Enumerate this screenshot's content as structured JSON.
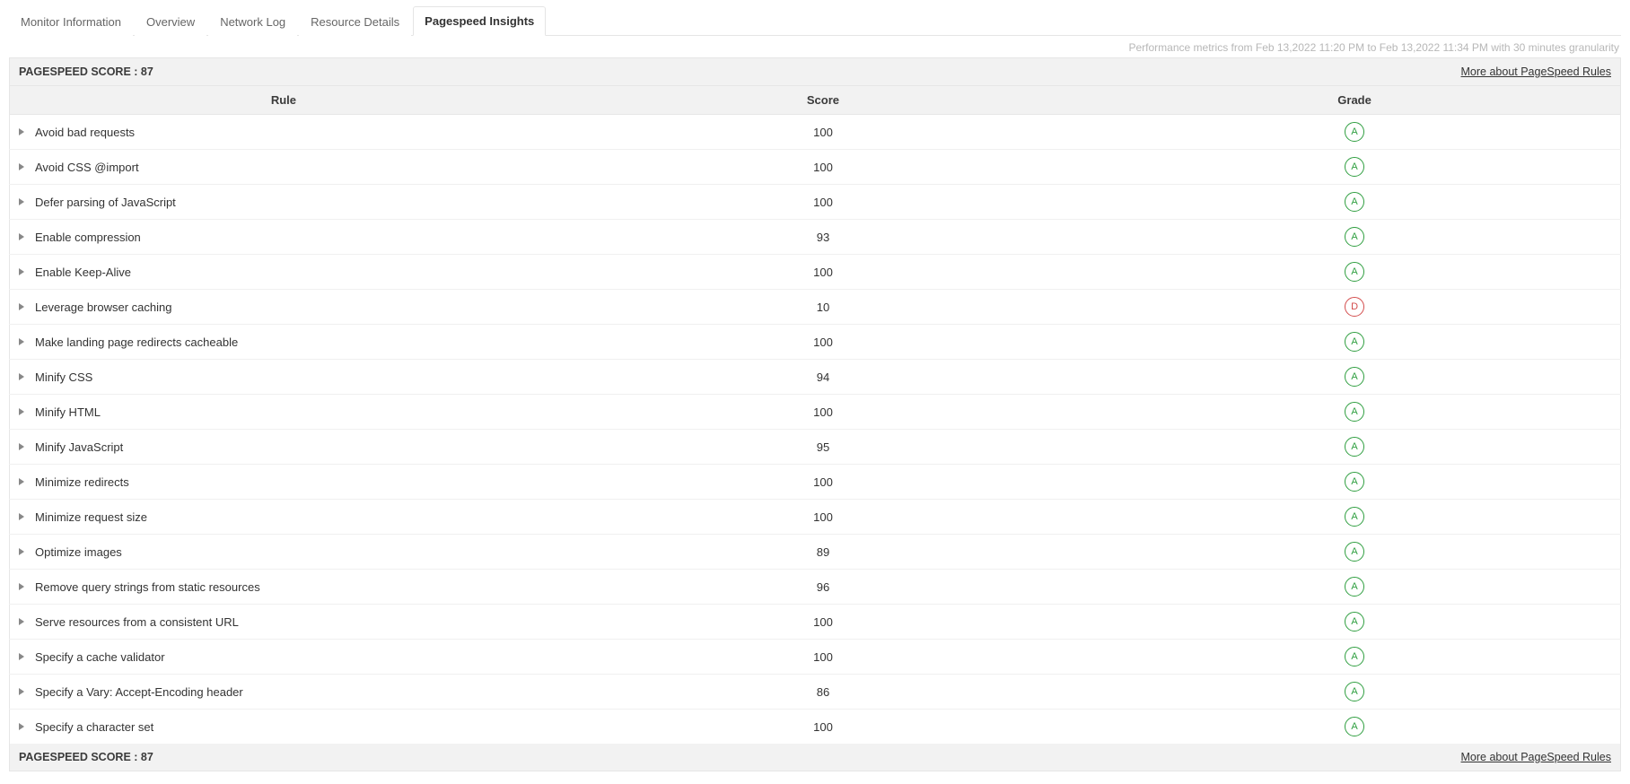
{
  "tabs": [
    {
      "label": "Monitor Information",
      "active": false
    },
    {
      "label": "Overview",
      "active": false
    },
    {
      "label": "Network Log",
      "active": false
    },
    {
      "label": "Resource Details",
      "active": false
    },
    {
      "label": "Pagespeed Insights",
      "active": true
    }
  ],
  "metrics_text": "Performance metrics from Feb 13,2022 11:20 PM to Feb 13,2022 11:34 PM with 30 minutes granularity",
  "score_header": {
    "label": "PAGESPEED SCORE : 87",
    "more_link": "More about PageSpeed Rules"
  },
  "columns": {
    "rule": "Rule",
    "score": "Score",
    "grade": "Grade"
  },
  "rows": [
    {
      "rule": "Avoid bad requests",
      "score": "100",
      "grade": "A"
    },
    {
      "rule": "Avoid CSS @import",
      "score": "100",
      "grade": "A"
    },
    {
      "rule": "Defer parsing of JavaScript",
      "score": "100",
      "grade": "A"
    },
    {
      "rule": "Enable compression",
      "score": "93",
      "grade": "A"
    },
    {
      "rule": "Enable Keep-Alive",
      "score": "100",
      "grade": "A"
    },
    {
      "rule": "Leverage browser caching",
      "score": "10",
      "grade": "D"
    },
    {
      "rule": "Make landing page redirects cacheable",
      "score": "100",
      "grade": "A"
    },
    {
      "rule": "Minify CSS",
      "score": "94",
      "grade": "A"
    },
    {
      "rule": "Minify HTML",
      "score": "100",
      "grade": "A"
    },
    {
      "rule": "Minify JavaScript",
      "score": "95",
      "grade": "A"
    },
    {
      "rule": "Minimize redirects",
      "score": "100",
      "grade": "A"
    },
    {
      "rule": "Minimize request size",
      "score": "100",
      "grade": "A"
    },
    {
      "rule": "Optimize images",
      "score": "89",
      "grade": "A"
    },
    {
      "rule": "Remove query strings from static resources",
      "score": "96",
      "grade": "A"
    },
    {
      "rule": "Serve resources from a consistent URL",
      "score": "100",
      "grade": "A"
    },
    {
      "rule": "Specify a cache validator",
      "score": "100",
      "grade": "A"
    },
    {
      "rule": "Specify a Vary: Accept-Encoding header",
      "score": "86",
      "grade": "A"
    },
    {
      "rule": "Specify a character set",
      "score": "100",
      "grade": "A"
    }
  ],
  "score_footer": {
    "label": "PAGESPEED SCORE : 87",
    "more_link": "More about PageSpeed Rules"
  }
}
